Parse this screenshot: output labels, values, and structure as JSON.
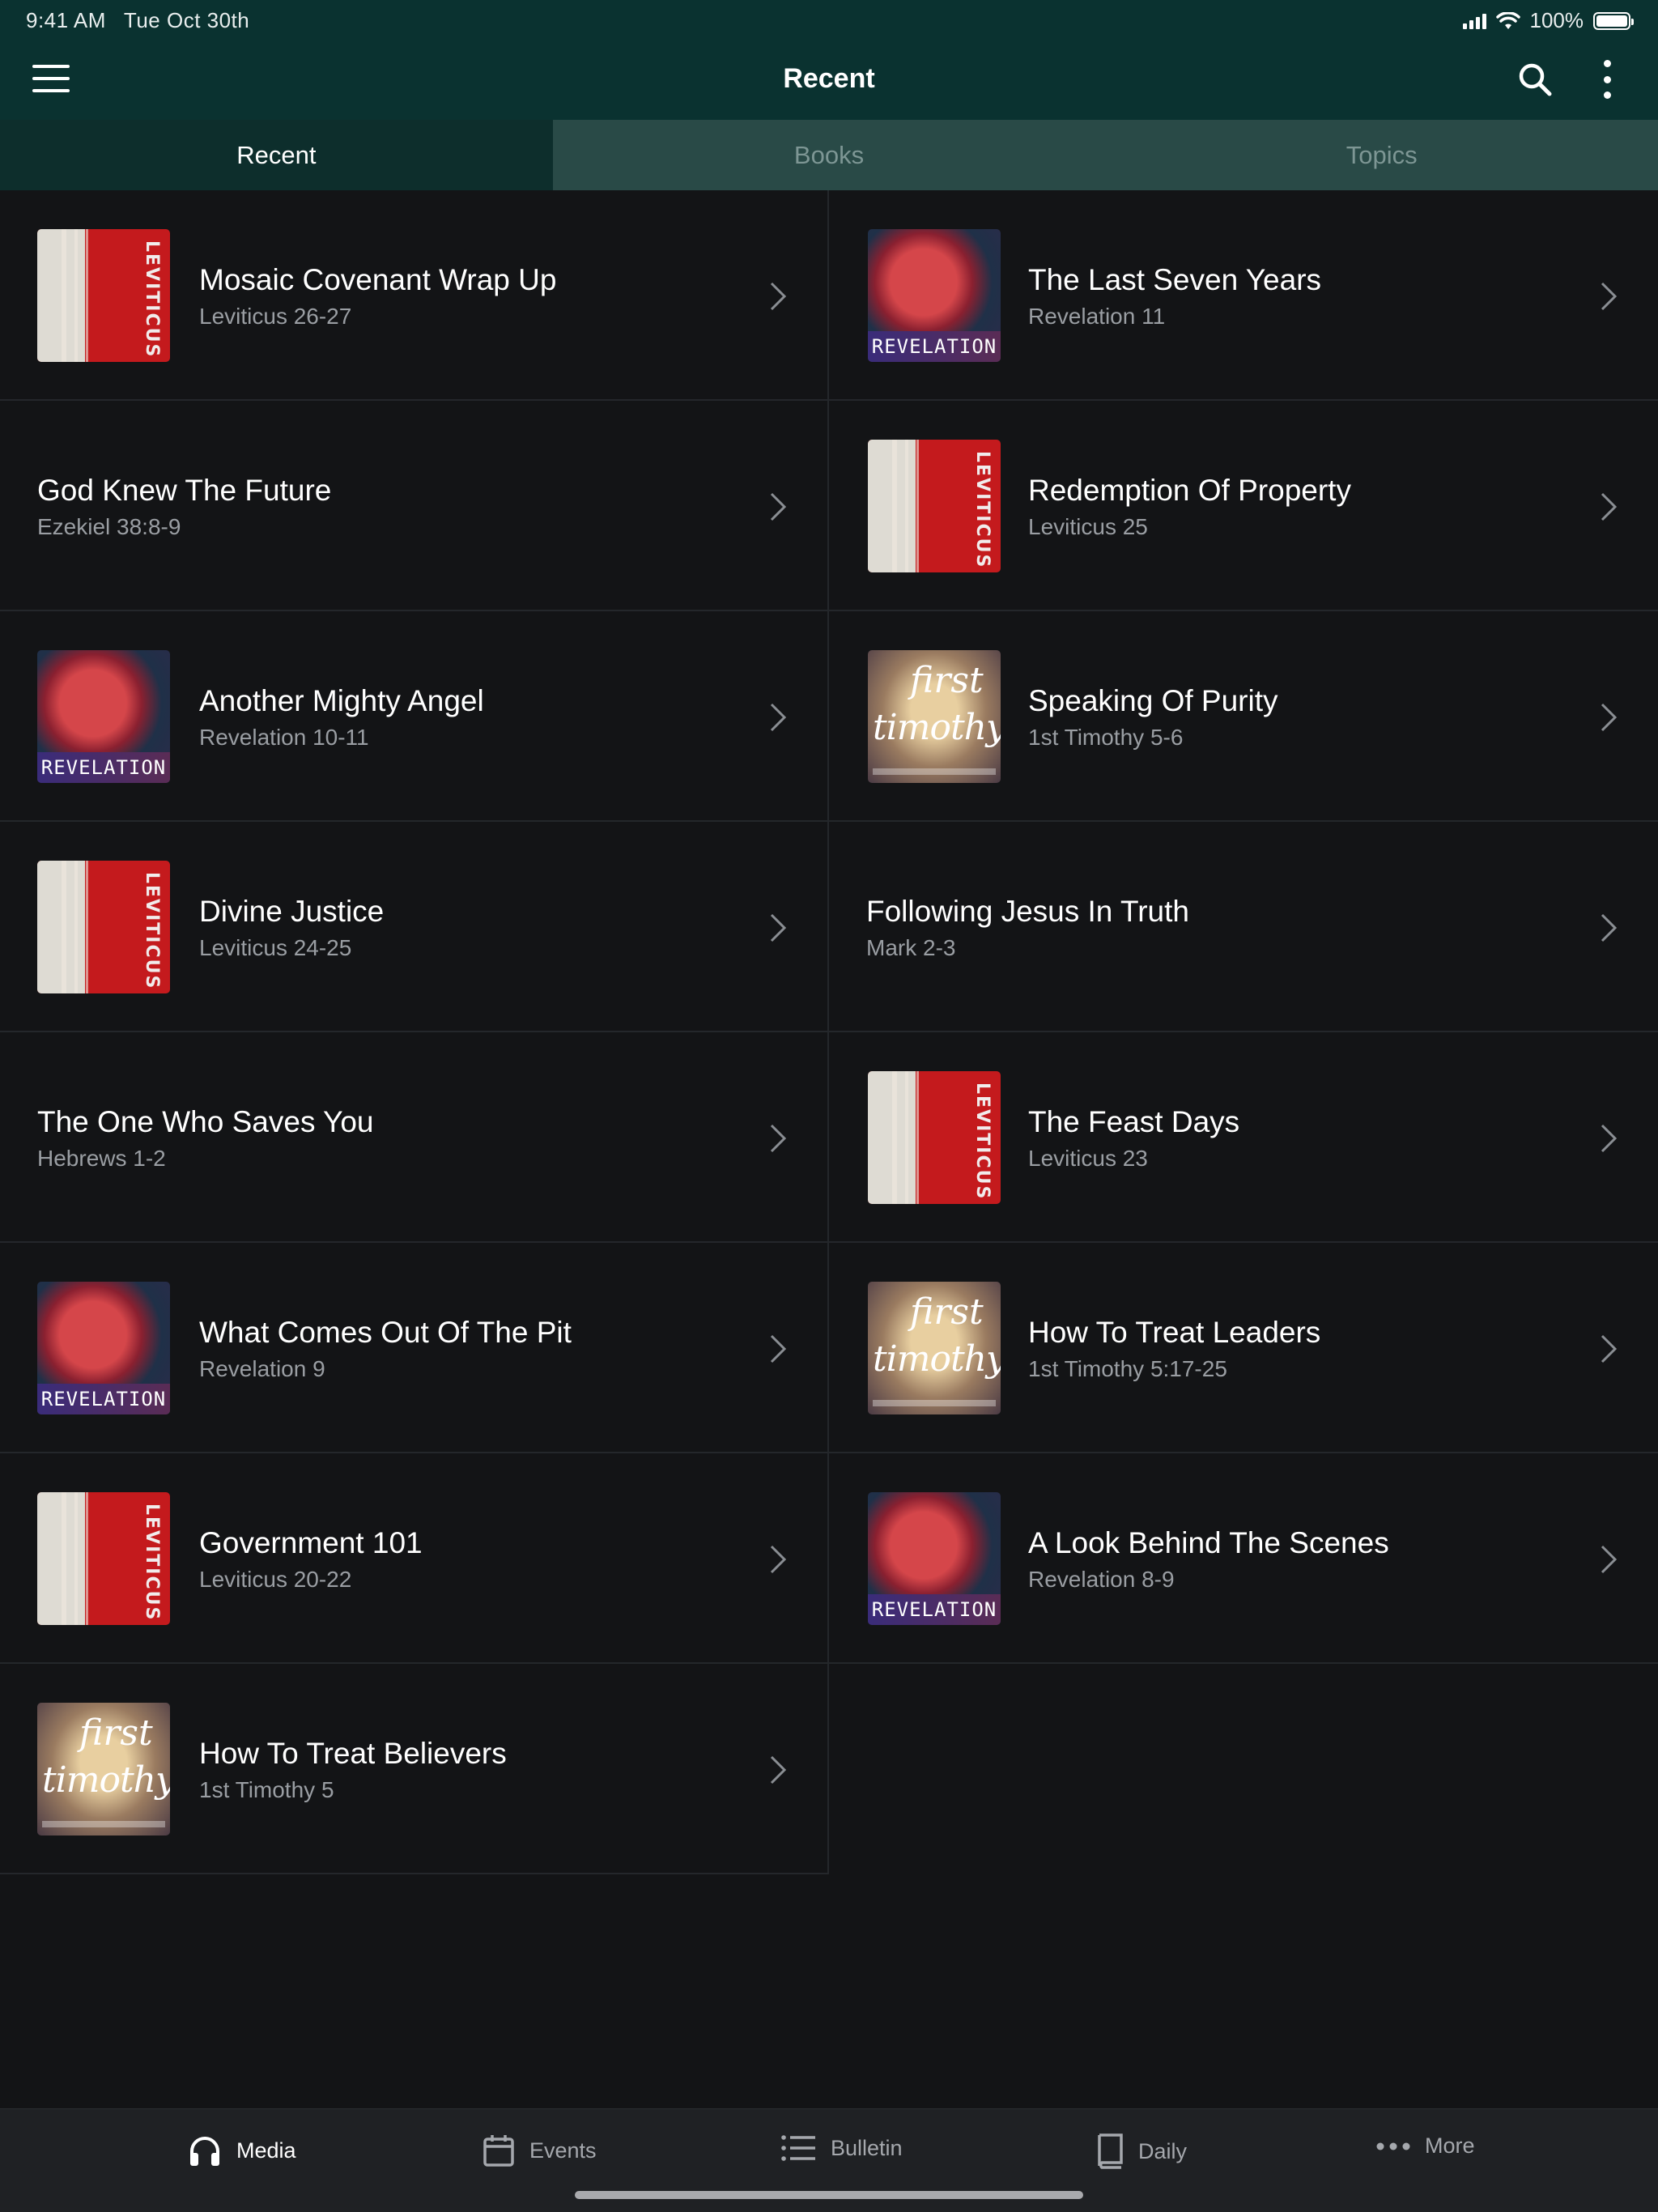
{
  "status_bar": {
    "time": "9:41 AM",
    "date": "Tue Oct 30th",
    "battery": "100%"
  },
  "header": {
    "title": "Recent"
  },
  "tabs": [
    {
      "label": "Recent",
      "active": true
    },
    {
      "label": "Books",
      "active": false
    },
    {
      "label": "Topics",
      "active": false
    }
  ],
  "items": [
    {
      "title": "Mosaic Covenant Wrap Up",
      "subtitle": "Leviticus 26-27",
      "art": "leviticus"
    },
    {
      "title": "The Last Seven Years",
      "subtitle": "Revelation 11",
      "art": "revelation"
    },
    {
      "title": "God Knew The Future",
      "subtitle": "Ezekiel 38:8-9",
      "art": "none"
    },
    {
      "title": "Redemption Of Property",
      "subtitle": "Leviticus 25",
      "art": "leviticus"
    },
    {
      "title": "Another Mighty Angel",
      "subtitle": "Revelation 10-11",
      "art": "revelation"
    },
    {
      "title": "Speaking Of Purity",
      "subtitle": "1st Timothy 5-6",
      "art": "timothy"
    },
    {
      "title": "Divine Justice",
      "subtitle": "Leviticus 24-25",
      "art": "leviticus"
    },
    {
      "title": "Following Jesus In Truth",
      "subtitle": "Mark 2-3",
      "art": "none"
    },
    {
      "title": "The One Who Saves You",
      "subtitle": "Hebrews 1-2",
      "art": "none"
    },
    {
      "title": "The Feast Days",
      "subtitle": "Leviticus 23",
      "art": "leviticus"
    },
    {
      "title": "What Comes Out Of The Pit",
      "subtitle": "Revelation 9",
      "art": "revelation"
    },
    {
      "title": "How To Treat Leaders",
      "subtitle": "1st Timothy 5:17-25",
      "art": "timothy"
    },
    {
      "title": "Government 101",
      "subtitle": "Leviticus 20-22",
      "art": "leviticus"
    },
    {
      "title": "A Look Behind The Scenes",
      "subtitle": "Revelation 8-9",
      "art": "revelation"
    },
    {
      "title": "How To Treat Believers",
      "subtitle": "1st Timothy 5",
      "art": "timothy"
    }
  ],
  "artwork": {
    "leviticus": "LEVITICUS",
    "revelation": "REVELATION",
    "timothy_line1": "first",
    "timothy_line2": "timothy"
  },
  "tabbar": [
    {
      "label": "Media",
      "icon": "headphones-icon",
      "active": true
    },
    {
      "label": "Events",
      "icon": "calendar-icon",
      "active": false
    },
    {
      "label": "Bulletin",
      "icon": "list-icon",
      "active": false
    },
    {
      "label": "Daily",
      "icon": "book-icon",
      "active": false
    },
    {
      "label": "More",
      "icon": "ellipsis-icon",
      "active": false
    }
  ],
  "colors": {
    "header": "#0a3230",
    "tab_active": "#0d2e2c",
    "tab_inactive": "#294a47",
    "background": "#131416"
  }
}
